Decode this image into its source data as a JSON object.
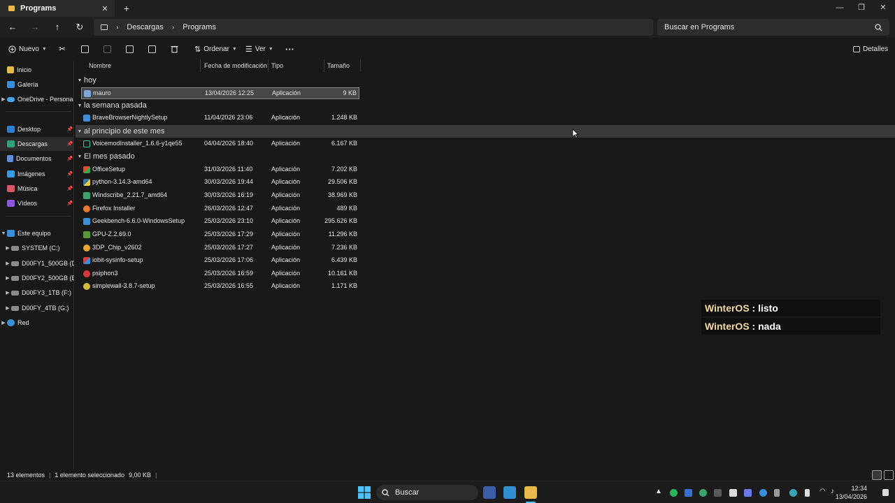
{
  "window": {
    "tab_title": "Programs",
    "minimize": "—",
    "maximize": "❐",
    "close": "✕"
  },
  "nav": {
    "breadcrumb": [
      "Descargas",
      "Programs"
    ],
    "search_placeholder": "Buscar en Programs"
  },
  "toolbar": {
    "new_label": "Nuevo",
    "sort_label": "Ordenar",
    "view_label": "Ver",
    "more_label": "···",
    "details_label": "Detalles"
  },
  "sidebar": {
    "items": [
      {
        "label": "Inicio"
      },
      {
        "label": "Galería"
      },
      {
        "label": "OneDrive - Persona"
      },
      {
        "label": "Desktop"
      },
      {
        "label": "Descargas"
      },
      {
        "label": "Documentos"
      },
      {
        "label": "Imágenes"
      },
      {
        "label": "Música"
      },
      {
        "label": "Vídeos"
      },
      {
        "label": "Este equipo"
      },
      {
        "label": "SYSTEM (C:)"
      },
      {
        "label": "D00FY1_500GB (D"
      },
      {
        "label": "D00FY2_500GB (E:"
      },
      {
        "label": "D00FY3_1TB (F:)"
      },
      {
        "label": "D00FY_4TB (G:)"
      },
      {
        "label": "Red"
      }
    ]
  },
  "columns": {
    "name": "Nombre",
    "date": "Fecha de modificación",
    "type": "Tipo",
    "size": "Tamaño"
  },
  "groups": [
    {
      "label": "hoy"
    },
    {
      "label": "la semana pasada"
    },
    {
      "label": "al principio de este mes"
    },
    {
      "label": "El mes pasado"
    }
  ],
  "files": [
    {
      "name": "mauro",
      "date": "13/04/2026 12:25",
      "type": "Aplicación",
      "size": "9 KB"
    },
    {
      "name": "BraveBrowserNightlySetup",
      "date": "11/04/2026 23:06",
      "type": "Aplicación",
      "size": "1.248 KB"
    },
    {
      "name": "VoicemodInstaller_1.6.6-y1qe55",
      "date": "04/04/2026 18:40",
      "type": "Aplicación",
      "size": "6.167 KB"
    },
    {
      "name": "OfficeSetup",
      "date": "31/03/2026 11:40",
      "type": "Aplicación",
      "size": "7.202 KB"
    },
    {
      "name": "python-3.14.3-amd64",
      "date": "30/03/2026 19:44",
      "type": "Aplicación",
      "size": "29.506 KB"
    },
    {
      "name": "Windscribe_2.21.7_amd64",
      "date": "30/03/2026 16:19",
      "type": "Aplicación",
      "size": "38.969 KB"
    },
    {
      "name": "Firefox Installer",
      "date": "26/03/2026 12:47",
      "type": "Aplicación",
      "size": "489 KB"
    },
    {
      "name": "Geekbench-6.6.0-WindowsSetup",
      "date": "25/03/2026 23:10",
      "type": "Aplicación",
      "size": "295.626 KB"
    },
    {
      "name": "GPU-Z.2.69.0",
      "date": "25/03/2026 17:29",
      "type": "Aplicación",
      "size": "11.296 KB"
    },
    {
      "name": "3DP_Chip_v2602",
      "date": "25/03/2026 17:27",
      "type": "Aplicación",
      "size": "7.236 KB"
    },
    {
      "name": "iobit-sysinfo-setup",
      "date": "25/03/2026 17:06",
      "type": "Aplicación",
      "size": "6.439 KB"
    },
    {
      "name": "psiphon3",
      "date": "25/03/2026 16:59",
      "type": "Aplicación",
      "size": "10.161 KB"
    },
    {
      "name": "simplewall-3.8.7-setup",
      "date": "25/03/2026 16:55",
      "type": "Aplicación",
      "size": "1.171 KB"
    }
  ],
  "overlay": [
    {
      "name": "WinterOS",
      "sep": " : ",
      "msg": "listo"
    },
    {
      "name": "WinterOS",
      "sep": " : ",
      "msg": "nada"
    }
  ],
  "status": {
    "count": "13 elementos",
    "selected": "1 elemento seleccionado",
    "size": "9,00 KB",
    "divider": "|"
  },
  "taskbar": {
    "search_label": "Buscar",
    "time": "12:34",
    "date": "13/04/2026"
  },
  "colors": {
    "accent": "#4cc2ff",
    "folder": "#e8b84a",
    "overlay_name": "#f2d9a0"
  }
}
